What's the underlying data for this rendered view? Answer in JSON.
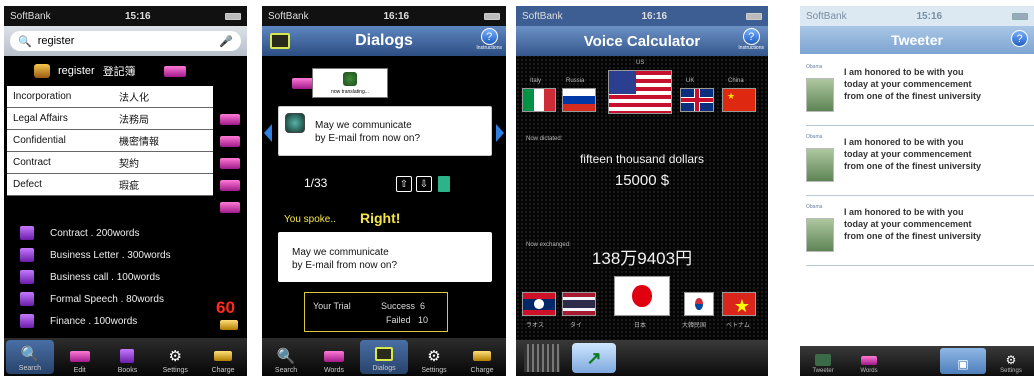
{
  "phone1": {
    "status": {
      "carrier": "SoftBank",
      "time": "15:16"
    },
    "search": {
      "value": "register"
    },
    "register_row": {
      "en": "register",
      "jp": "登記簿"
    },
    "results": [
      {
        "en": "Incorporation",
        "jp": "法人化"
      },
      {
        "en": "Legal Affairs",
        "jp": "法務局"
      },
      {
        "en": "Confidential",
        "jp": "機密情報"
      },
      {
        "en": "Contract",
        "jp": "契約"
      },
      {
        "en": "Defect",
        "jp": "瑕疵"
      }
    ],
    "vocab": [
      {
        "label": "Contract . 200words"
      },
      {
        "label": "Business Letter . 300words"
      },
      {
        "label": "Business call . 100words"
      },
      {
        "label": "Formal Speech . 80words"
      },
      {
        "label": "Finance . 100words"
      }
    ],
    "score": "60",
    "tabs": [
      {
        "label": "Search",
        "icon": "search-icon"
      },
      {
        "label": "Edit",
        "icon": "gift-icon"
      },
      {
        "label": "Books",
        "icon": "book-icon"
      },
      {
        "label": "Settings",
        "icon": "gear-icon"
      },
      {
        "label": "Charge",
        "icon": "coins-icon"
      }
    ]
  },
  "phone2": {
    "status": {
      "carrier": "SoftBank",
      "time": "16:16"
    },
    "title": "Dialogs",
    "instructions_label": "Instructions",
    "translating_label": "now translating...",
    "dialog_text": [
      "May we communicate",
      "by E-mail from now on?"
    ],
    "counter": "1/33",
    "spoke_label": "You spoke..",
    "result": "Right!",
    "spoken_text": [
      "May we communicate",
      "by E-mail from now on?"
    ],
    "trial": {
      "label": "Your Trial",
      "success_label": "Success",
      "success": "6",
      "failed_label": "Failed",
      "failed": "10"
    },
    "tabs": [
      {
        "label": "Search",
        "icon": "search-icon"
      },
      {
        "label": "Words",
        "icon": "gift-icon"
      },
      {
        "label": "Dialogs",
        "icon": "cassette-icon"
      },
      {
        "label": "Settings",
        "icon": "gear-icon"
      },
      {
        "label": "Charge",
        "icon": "coins-icon"
      }
    ]
  },
  "phone3": {
    "status": {
      "carrier": "SoftBank",
      "time": "16:16"
    },
    "title": "Voice Calculator",
    "instructions_label": "Instructions",
    "top_label": "US",
    "flag_labels_top": [
      "Italy",
      "Russia",
      "UK",
      "China"
    ],
    "now_dictated_label": "Now dictated:",
    "dictated_words": "fifteen thousand dollars",
    "dictated_amount": "15000 $",
    "now_exchanged_label": "Now exchanged:",
    "exchanged_amount": "138万9403円",
    "flag_labels_bottom": [
      "ラオス",
      "タイ",
      "日本",
      "大韓民国",
      "ベトナム"
    ]
  },
  "phone4": {
    "status": {
      "carrier": "SoftBank",
      "time": "15:16"
    },
    "title": "Tweeter",
    "tweets": [
      {
        "user": "Obama",
        "text": [
          "I am honored to be with you",
          "today at your commencement",
          "from one of the finest university"
        ]
      },
      {
        "user": "Obama",
        "text": [
          "I am honored to be with you",
          "today at your commencement",
          "from one of the finest university"
        ]
      },
      {
        "user": "Obama",
        "text": [
          "I am honored to be with you",
          "today at your commencement",
          "from one of the finest university"
        ]
      }
    ],
    "tabs": [
      {
        "label": "Tweeter",
        "icon": "app-icon"
      },
      {
        "label": "Words",
        "icon": "gift-icon"
      },
      {
        "label": "",
        "icon": "blank-icon"
      },
      {
        "label": "",
        "icon": "cassette-icon"
      },
      {
        "label": "Settings",
        "icon": "gear-icon"
      }
    ]
  }
}
